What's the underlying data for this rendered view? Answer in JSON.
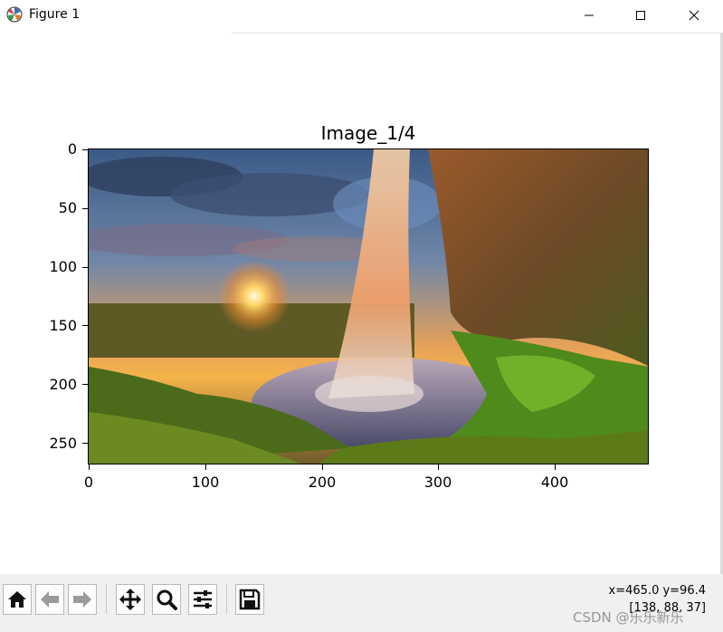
{
  "window": {
    "title": "Figure 1",
    "app_icon": "matplotlib-icon",
    "controls": [
      "minimize-icon",
      "maximize-icon",
      "close-icon"
    ]
  },
  "plot": {
    "title": "Image_1/4",
    "image_description_icon": "landscape-waterfall-sunset",
    "y_ticks": [
      "0",
      "50",
      "100",
      "150",
      "200",
      "250"
    ],
    "x_ticks": [
      "0",
      "100",
      "200",
      "300",
      "400"
    ]
  },
  "toolbar": {
    "buttons": [
      "home-icon",
      "back-icon",
      "forward-icon",
      "pan-icon",
      "zoom-icon",
      "configure-subplots-icon",
      "save-icon"
    ],
    "coords_line1": "x=465.0 y=96.4",
    "coords_line2": "[138, 88, 37]"
  },
  "watermark": "CSDN @乐乐新乐"
}
